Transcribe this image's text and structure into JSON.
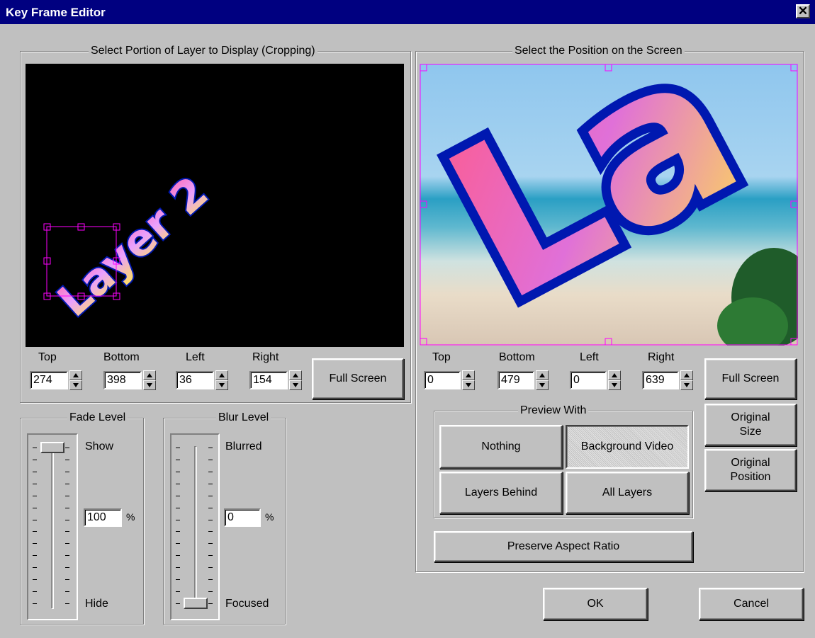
{
  "window": {
    "title": "Key Frame Editor",
    "close_glyph": "✕"
  },
  "cropping": {
    "group_label": "Select Portion of Layer to Display (Cropping)",
    "preview_text": "Layer 2",
    "fields": [
      {
        "label": "Top",
        "value": "274"
      },
      {
        "label": "Bottom",
        "value": "398"
      },
      {
        "label": "Left",
        "value": "36"
      },
      {
        "label": "Right",
        "value": "154"
      }
    ],
    "full_screen_label": "Full Screen"
  },
  "position": {
    "group_label": "Select the Position on the Screen",
    "preview_text": "La",
    "fields": [
      {
        "label": "Top",
        "value": "0"
      },
      {
        "label": "Bottom",
        "value": "479"
      },
      {
        "label": "Left",
        "value": "0"
      },
      {
        "label": "Right",
        "value": "639"
      }
    ],
    "full_screen_label": "Full Screen",
    "original_size_label": "Original Size",
    "original_position_label": "Original Position"
  },
  "preview_with": {
    "group_label": "Preview With",
    "options": {
      "nothing": "Nothing",
      "background_video": "Background Video",
      "layers_behind": "Layers Behind",
      "all_layers": "All Layers"
    },
    "selected": "Background Video"
  },
  "preserve_aspect_label": "Preserve Aspect Ratio",
  "fade": {
    "group_label": "Fade Level",
    "top_label": "Show",
    "bottom_label": "Hide",
    "value": "100",
    "unit": "%",
    "level": 1.0
  },
  "blur": {
    "group_label": "Blur Level",
    "top_label": "Blurred",
    "bottom_label": "Focused",
    "value": "0",
    "unit": "%",
    "level": 0.0
  },
  "buttons": {
    "ok": "OK",
    "cancel": "Cancel"
  },
  "icons": {
    "spin_up": "triangle-up-icon",
    "spin_down": "triangle-down-icon"
  },
  "colors": {
    "title_bg": "#000080",
    "face": "#c0c0c0",
    "selection": "#ff00ff",
    "text_outline": "#0018b0"
  }
}
